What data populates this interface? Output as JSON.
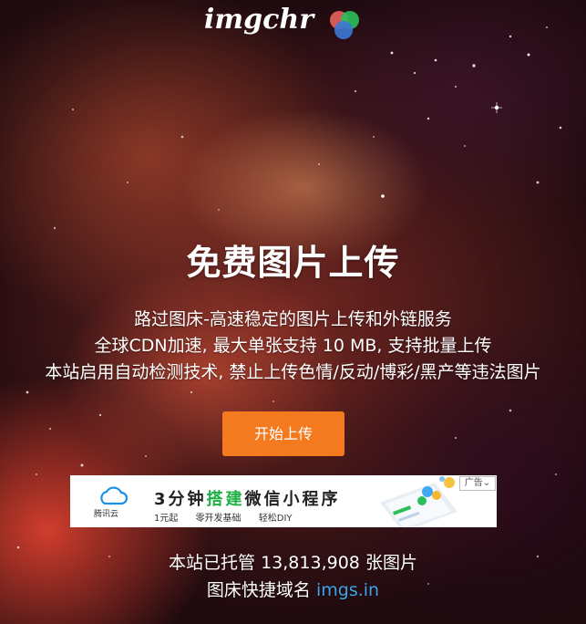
{
  "header": {
    "logo_text": "imgchr"
  },
  "hero": {
    "title": "免费图片上传",
    "description_lines": [
      "路过图床-高速稳定的图片上传和外链服务",
      "全球CDN加速, 最大单张支持 10 MB, 支持批量上传",
      "本站启用自动检测技术, 禁止上传色情/反动/博彩/黑产等违法图片"
    ],
    "upload_button_label": "开始上传"
  },
  "ad": {
    "brand": "腾讯云",
    "headline_pre": "3分钟",
    "headline_highlight": "搭建",
    "headline_post": "微信小程序",
    "features": [
      "1元起",
      "零开发基础",
      "轻松DIY"
    ],
    "tag": "广告"
  },
  "stats": {
    "hosted_prefix": "本站已托管",
    "hosted_count": "13,813,908",
    "hosted_suffix": "张图片",
    "domain_label": "图床快捷域名",
    "domain_link": "imgs.in"
  },
  "colors": {
    "accent_button": "#f47a20",
    "link": "#3ea3e8",
    "ad_highlight": "#1cb043",
    "logo_red": "#e8615c",
    "logo_green": "#2bbf5a",
    "logo_blue": "#3a78d6"
  }
}
